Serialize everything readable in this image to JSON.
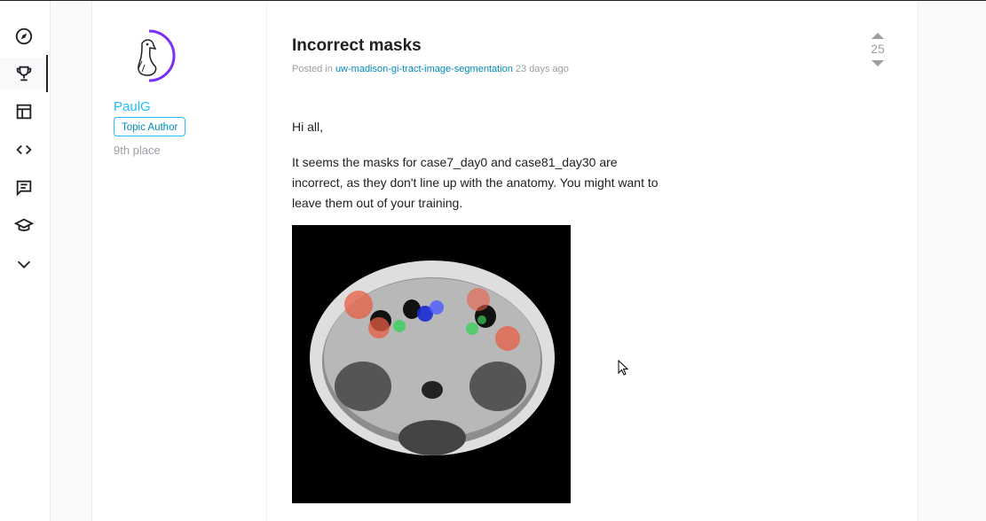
{
  "sidebar": {
    "items": [
      {
        "name": "explore",
        "icon": "compass-icon",
        "active": false
      },
      {
        "name": "competitions",
        "icon": "trophy-icon",
        "active": true
      },
      {
        "name": "datasets",
        "icon": "table-icon",
        "active": false
      },
      {
        "name": "code",
        "icon": "code-icon",
        "active": false
      },
      {
        "name": "discussions",
        "icon": "comment-icon",
        "active": false
      },
      {
        "name": "learn",
        "icon": "graduation-cap-icon",
        "active": false
      },
      {
        "name": "more",
        "icon": "chevron-down-icon",
        "active": false
      }
    ]
  },
  "author": {
    "name": "PaulG",
    "badge": "Topic Author",
    "rank": "9th place",
    "avatar_ring_color": "#7b2ff7"
  },
  "post": {
    "title": "Incorrect masks",
    "meta_prefix": "Posted in",
    "competition": "uw-madison-gi-tract-image-segmentation",
    "time_ago": "23 days ago",
    "votes": "25",
    "paragraphs": [
      "Hi all,",
      "It seems the masks for case7_day0 and case81_day30 are incorrect, as they don't line up with the anatomy. You might want to leave them out of your training."
    ]
  },
  "colors": {
    "accent": "#20beff",
    "link": "#008aba",
    "muted": "#9aa0a6",
    "text": "#202124"
  }
}
